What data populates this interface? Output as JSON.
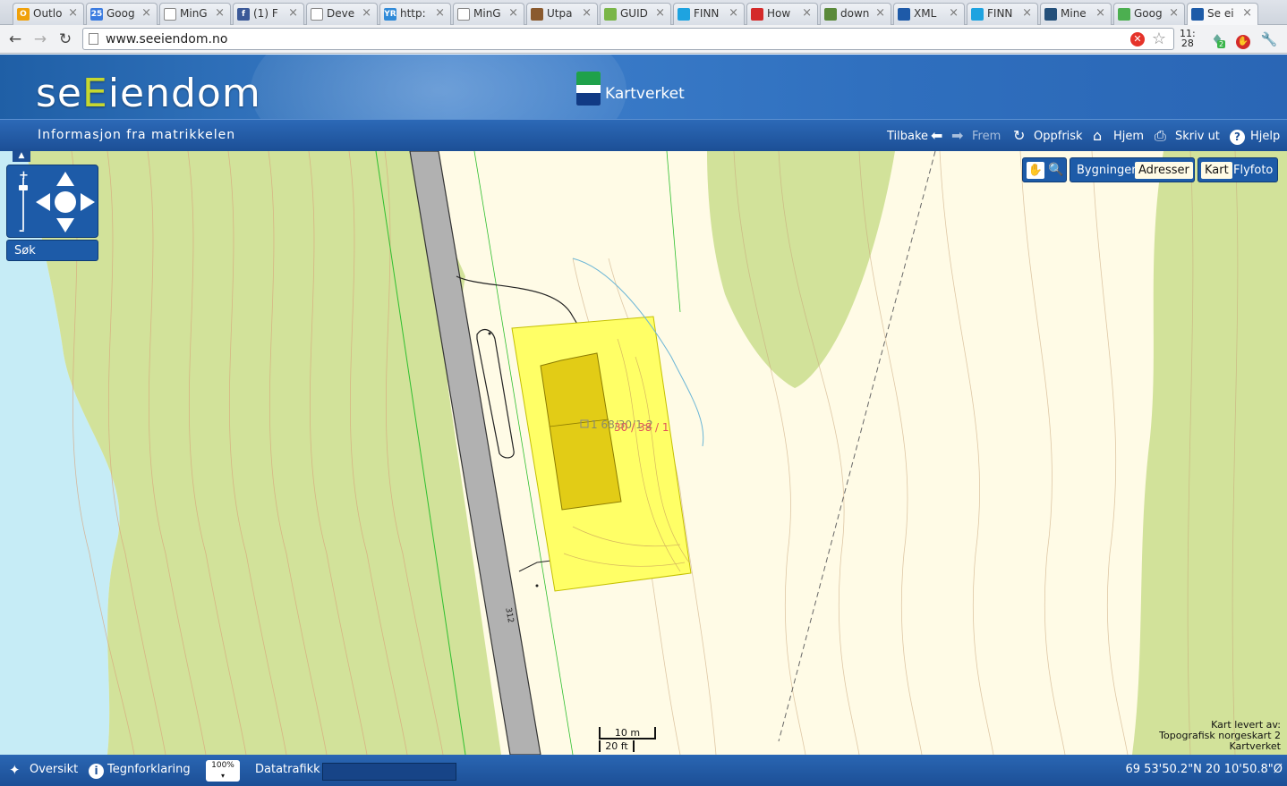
{
  "browser": {
    "tabs": [
      {
        "label": "Outlo",
        "color": "#f0a10a",
        "glyph": "O"
      },
      {
        "label": "Goog",
        "color": "#3a7be0",
        "glyph": "25"
      },
      {
        "label": "MinG",
        "color": "#ffffff",
        "glyph": ""
      },
      {
        "label": "(1) F",
        "color": "#3b5998",
        "glyph": "f"
      },
      {
        "label": "Deve",
        "color": "#ffffff",
        "glyph": ""
      },
      {
        "label": "http:",
        "color": "#2f8ad8",
        "glyph": "YR"
      },
      {
        "label": "MinG",
        "color": "#ffffff",
        "glyph": ""
      },
      {
        "label": "Utpa",
        "color": "#8a5a2e",
        "glyph": ""
      },
      {
        "label": "GUID",
        "color": "#7ab648",
        "glyph": ""
      },
      {
        "label": "FINN",
        "color": "#1ea3e0",
        "glyph": ""
      },
      {
        "label": "How",
        "color": "#d42a2a",
        "glyph": ""
      },
      {
        "label": "down",
        "color": "#5a8a3a",
        "glyph": ""
      },
      {
        "label": "XML",
        "color": "#1e5aa8",
        "glyph": ""
      },
      {
        "label": "FINN",
        "color": "#1ea3e0",
        "glyph": ""
      },
      {
        "label": "Mine",
        "color": "#24507a",
        "glyph": ""
      },
      {
        "label": "Goog",
        "color": "#4caf50",
        "glyph": ""
      },
      {
        "label": "Se ei",
        "color": "#1d5ba8",
        "glyph": "",
        "active": true
      }
    ],
    "url": "www.seeiendom.no",
    "clock_top": "11:",
    "clock_bottom": "28",
    "badge_count": "2"
  },
  "site": {
    "logo_prefix": "se",
    "logo_highlight": "E",
    "logo_suffix": "iendom",
    "partner_name": "Kartverket",
    "subtitle": "Informasjon fra matrikkelen",
    "nav": {
      "back": "Tilbake",
      "forward": "Frem",
      "refresh": "Oppfrisk",
      "home": "Hjem",
      "print": "Skriv ut",
      "help": "Hjelp"
    }
  },
  "map": {
    "search_label": "Søk",
    "layers": {
      "buildings": "Bygninger",
      "addresses": "Adresser",
      "addresses_selected": true
    },
    "basemaps": {
      "map": "Kart",
      "aerial": "Flyfoto",
      "map_selected": true
    },
    "parcel_label": "1 68/30/1-2",
    "parcel_label_red": "30 / 38 / 1",
    "road_label": "312",
    "scale_metric": "10 m",
    "scale_imperial": "20 ft",
    "attribution": [
      "Kart levert av:",
      "Topografisk norgeskart 2",
      "Kartverket"
    ],
    "colors": {
      "forest": "#d2e29a",
      "open": "#fffbe6",
      "water": "#c6ecf6",
      "parcel": "#ffff66",
      "building": "#e2cc16",
      "road": "#b1b1b1"
    }
  },
  "status": {
    "overview": "Oversikt",
    "legend": "Tegnforklaring",
    "zoom_percent": "100%",
    "traffic_label": "Datatrafikk",
    "coordinates": "69 53'50.2\"N 20 10'50.8\"Ø"
  }
}
